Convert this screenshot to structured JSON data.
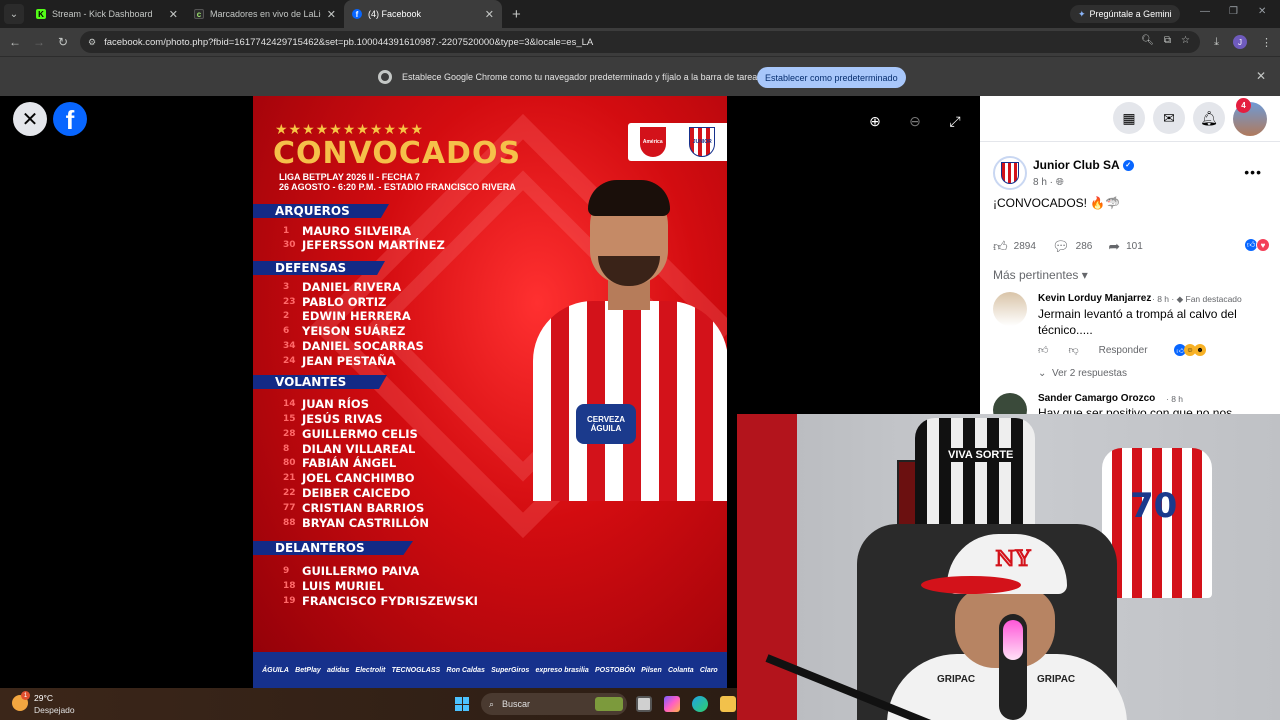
{
  "browser": {
    "tabs": [
      {
        "title": "Stream - Kick Dashboard",
        "icon": "kick-icon",
        "active": false
      },
      {
        "title": "Marcadores en vivo de LaLiga ...",
        "icon": "livescore-icon",
        "active": false
      },
      {
        "title": "(4) Facebook",
        "icon": "facebook-icon",
        "active": true
      }
    ],
    "gemini_label": "Pregúntale a Gemini",
    "url": "facebook.com/photo.php?fbid=1617742429715462&set=pb.100044391610987.-2207520000&type=3&locale=es_LA",
    "profile_initial": "J",
    "infobar": {
      "message": "Establece Google Chrome como tu navegador predeterminado y fíjalo a la barra de tareas",
      "button": "Establecer como predeterminado"
    }
  },
  "poster": {
    "stars": "★★★★★★★★★★★",
    "title": "CONVOCADOS",
    "subtitle_line1": "LIGA BETPLAY 2026 II - FECHA 7",
    "subtitle_line2": "26 AGOSTO - 6:20 P.M. - ESTADIO FRANCISCO RIVERA",
    "sections": [
      {
        "name": "ARQUEROS",
        "players": [
          {
            "num": "1",
            "name": "MAURO SILVEIRA"
          },
          {
            "num": "30",
            "name": "JEFERSSON MARTÍNEZ"
          }
        ]
      },
      {
        "name": "DEFENSAS",
        "players": [
          {
            "num": "3",
            "name": "DANIEL RIVERA"
          },
          {
            "num": "23",
            "name": "PABLO ORTIZ"
          },
          {
            "num": "2",
            "name": "EDWIN HERRERA"
          },
          {
            "num": "6",
            "name": "YEISON SUÁREZ"
          },
          {
            "num": "34",
            "name": "DANIEL SOCARRAS"
          },
          {
            "num": "24",
            "name": "JEAN PESTAÑA"
          }
        ]
      },
      {
        "name": "VOLANTES",
        "players": [
          {
            "num": "14",
            "name": "JUAN RÍOS"
          },
          {
            "num": "15",
            "name": "JESÚS RIVAS"
          },
          {
            "num": "28",
            "name": "GUILLERMO CELIS"
          },
          {
            "num": "8",
            "name": "DILAN VILLAREAL"
          },
          {
            "num": "80",
            "name": "FABIÁN ÁNGEL"
          },
          {
            "num": "21",
            "name": "JOEL CANCHIMBO"
          },
          {
            "num": "22",
            "name": "DEIBER CAICEDO"
          },
          {
            "num": "77",
            "name": "CRISTIAN BARRIOS"
          },
          {
            "num": "88",
            "name": "BRYAN CASTRILLÓN"
          }
        ]
      },
      {
        "name": "DELANTEROS",
        "players": [
          {
            "num": "9",
            "name": "GUILLERMO PAIVA"
          },
          {
            "num": "18",
            "name": "LUIS MURIEL"
          },
          {
            "num": "19",
            "name": "FRANCISCO FYDRISZEWSKI"
          }
        ]
      }
    ],
    "crest_left": "América",
    "crest_right": "JUNIOR",
    "player_sponsor": "CERVEZA ÁGUILA",
    "sponsors": [
      "ÁGUILA",
      "BetPlay",
      "adidas",
      "Electrolit",
      "TECNOGLASS",
      "Ron Caldas",
      "SuperGiros",
      "expreso brasilia",
      "POSTOBÓN",
      "Pilsen",
      "Colanta",
      "Claro"
    ]
  },
  "facebook": {
    "notifications": "4",
    "post": {
      "author": "Junior Club SA",
      "time": "8 h",
      "text": "¡CONVOCADOS! 🔥🦈",
      "likes": "2894",
      "comments": "286",
      "shares": "101"
    },
    "filter_label": "Más pertinentes",
    "comments": [
      {
        "author": "Kevin Lorduy Manjarrez",
        "time": "8 h",
        "badge": "Fan destacado",
        "text": "Jermain levantó a trompá al calvo del técnico.....",
        "reply_label": "Responder",
        "replies_label": "Ver 2 respuestas"
      },
      {
        "author": "Sander Camargo Orozco",
        "time": "8 h",
        "text": "Hay que ser positivo con que no nos"
      }
    ]
  },
  "webcam": {
    "jersey_left": "VIVA SORTE",
    "jersey_right": "70",
    "shirt_sponsor": "GRIPAC"
  },
  "taskbar": {
    "temperature": "29°C",
    "condition": "Despejado",
    "weather_badge": "1",
    "search_placeholder": "Buscar"
  }
}
